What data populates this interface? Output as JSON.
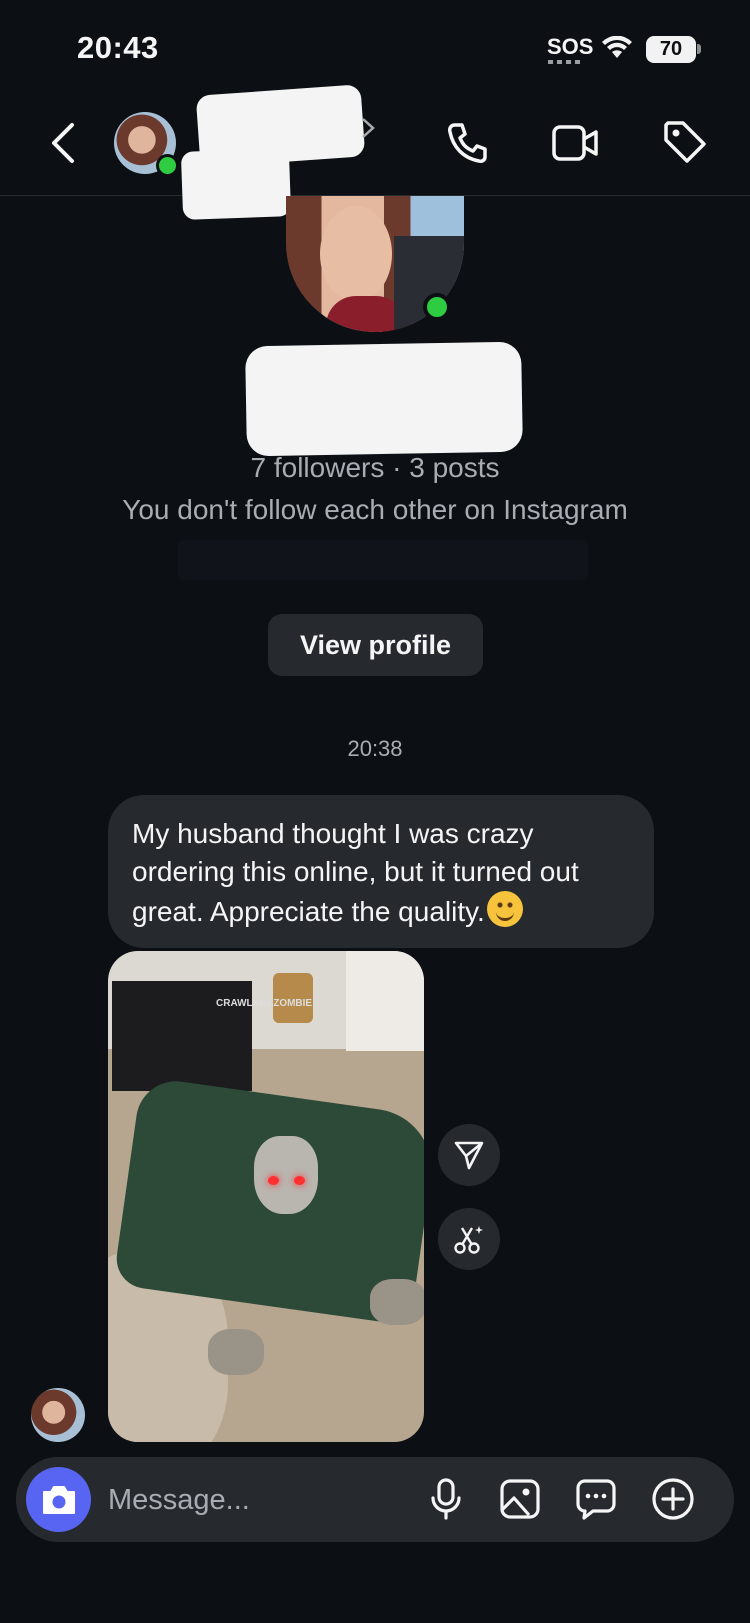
{
  "status_bar": {
    "time": "20:43",
    "sos": "SOS",
    "battery": "70"
  },
  "profile": {
    "followers_line": "7 followers · 3 posts",
    "relationship_note": "You don't follow each other on Instagram",
    "view_profile_label": "View profile"
  },
  "thread": {
    "timestamp": "20:38",
    "message_text": "My husband thought I was crazy ordering this online, but it turned out great. Appreciate the quality.",
    "photo_box_text": "CRAWLING ZOMBIE"
  },
  "composer": {
    "placeholder": "Message..."
  },
  "colors": {
    "background": "#0c1014",
    "bubble": "#262a2f",
    "accent": "#5865f2",
    "online": "#2ecc40"
  }
}
